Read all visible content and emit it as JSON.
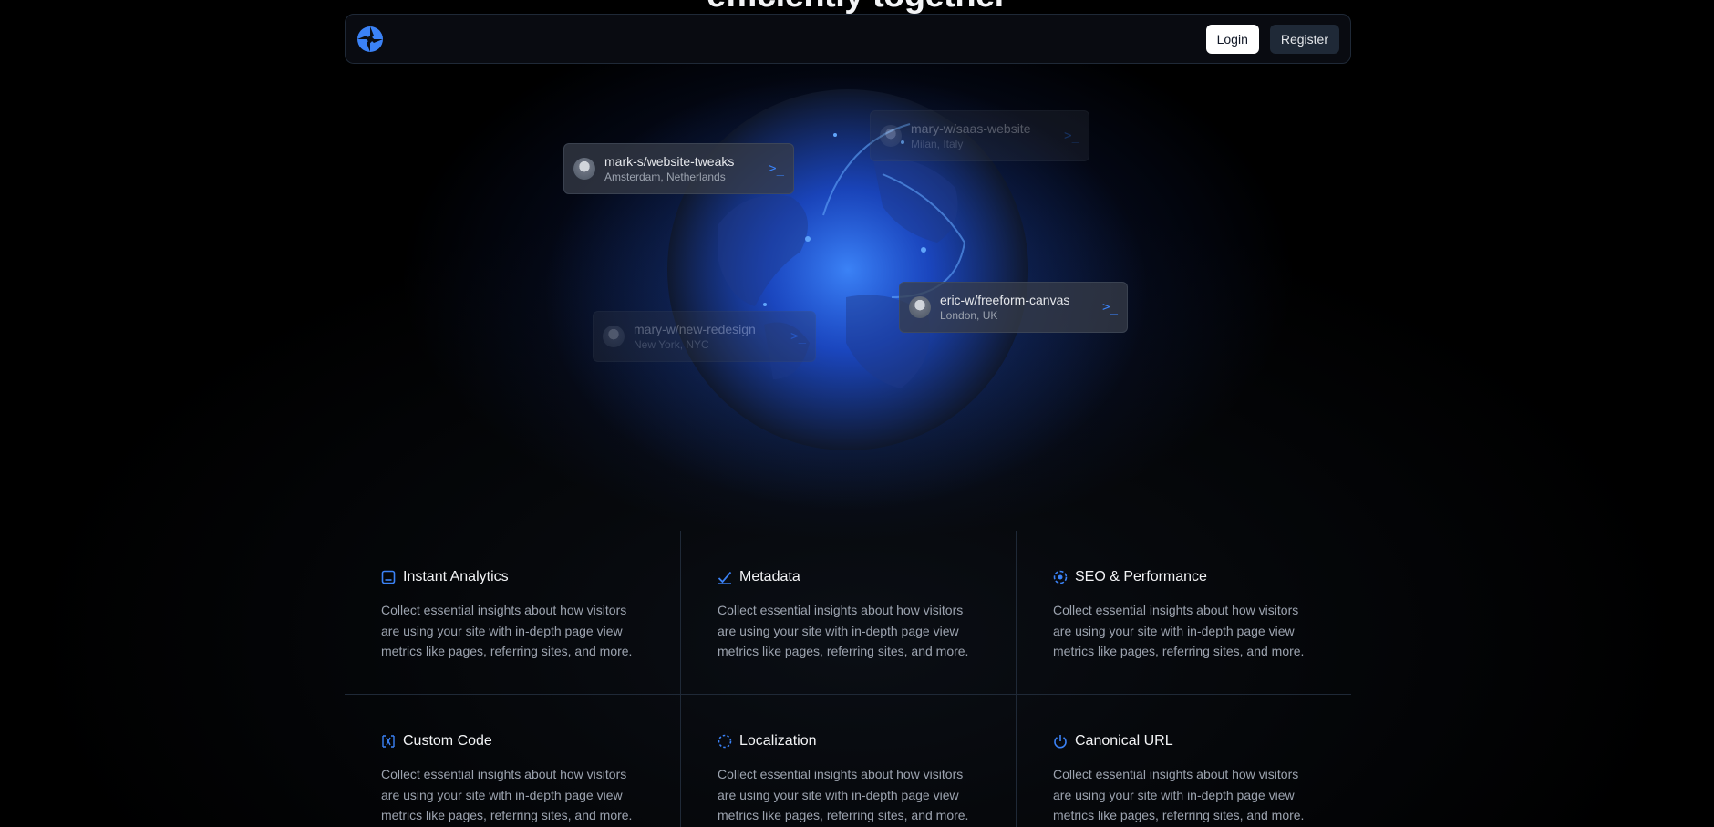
{
  "hero": {
    "partial_title": "efficiently together"
  },
  "nav": {
    "login_label": "Login",
    "register_label": "Register",
    "logo_icon": "aperture-logo-icon"
  },
  "accent": "#3b82f6",
  "collaborators": [
    {
      "repo": "mark-s/website-tweaks",
      "location": "Amsterdam, Netherlands",
      "icon": "terminal-icon"
    },
    {
      "repo": "mary-w/saas-website",
      "location": "Milan, Italy",
      "icon": "terminal-icon"
    },
    {
      "repo": "eric-w/freeform-canvas",
      "location": "London, UK",
      "icon": "terminal-icon"
    },
    {
      "repo": "mary-w/new-redesign",
      "location": "New York, NYC",
      "icon": "terminal-icon"
    }
  ],
  "features": [
    {
      "title": "Instant Analytics",
      "icon": "analytics-icon",
      "description": "Collect essential insights about how visitors are using your site with in-depth page view metrics like pages, referring sites, and more."
    },
    {
      "title": "Metadata",
      "icon": "check-icon",
      "description": "Collect essential insights about how visitors are using your site with in-depth page view metrics like pages, referring sites, and more."
    },
    {
      "title": "SEO & Performance",
      "icon": "target-icon",
      "description": "Collect essential insights about how visitors are using your site with in-depth page view metrics like pages, referring sites, and more."
    },
    {
      "title": "Custom Code",
      "icon": "code-brackets-icon",
      "description": "Collect essential insights about how visitors are using your site with in-depth page view metrics like pages, referring sites, and more."
    },
    {
      "title": "Localization",
      "icon": "dashed-circle-icon",
      "description": "Collect essential insights about how visitors are using your site with in-depth page view metrics like pages, referring sites, and more."
    },
    {
      "title": "Canonical URL",
      "icon": "power-icon",
      "description": "Collect essential insights about how visitors are using your site with in-depth page view metrics like pages, referring sites, and more."
    }
  ]
}
